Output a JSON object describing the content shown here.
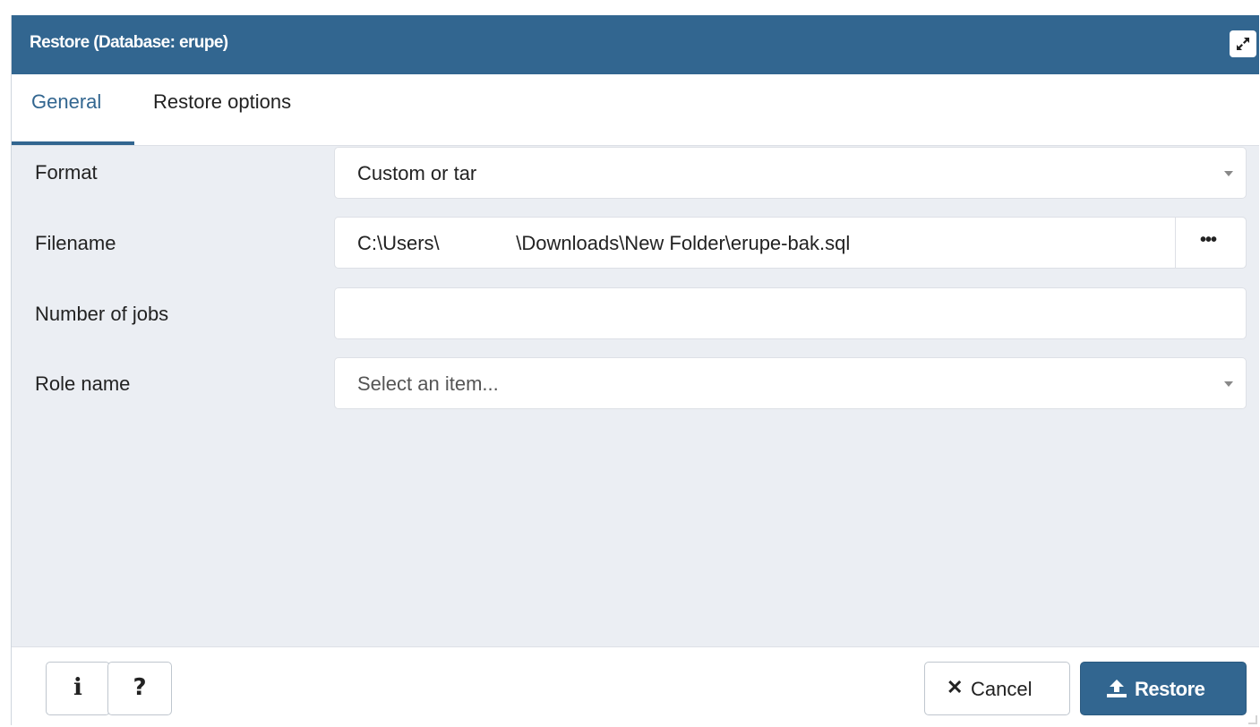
{
  "dialog": {
    "title": "Restore (Database: erupe)",
    "maximize_icon": "expand-icon"
  },
  "tabs": [
    {
      "label": "General",
      "active": true
    },
    {
      "label": "Restore options",
      "active": false
    }
  ],
  "form": {
    "format": {
      "label": "Format",
      "value": "Custom or tar"
    },
    "filename": {
      "label": "Filename",
      "value": "C:\\Users\\              \\Downloads\\New Folder\\erupe-bak.sql",
      "browse_label": "•••"
    },
    "jobs": {
      "label": "Number of jobs",
      "value": ""
    },
    "role": {
      "label": "Role name",
      "placeholder": "Select an item..."
    }
  },
  "footer": {
    "info_label": "i",
    "help_label": "?",
    "cancel_label": "Cancel",
    "restore_label": "Restore"
  },
  "colors": {
    "accent": "#326690",
    "body_bg": "#ebeef3"
  }
}
